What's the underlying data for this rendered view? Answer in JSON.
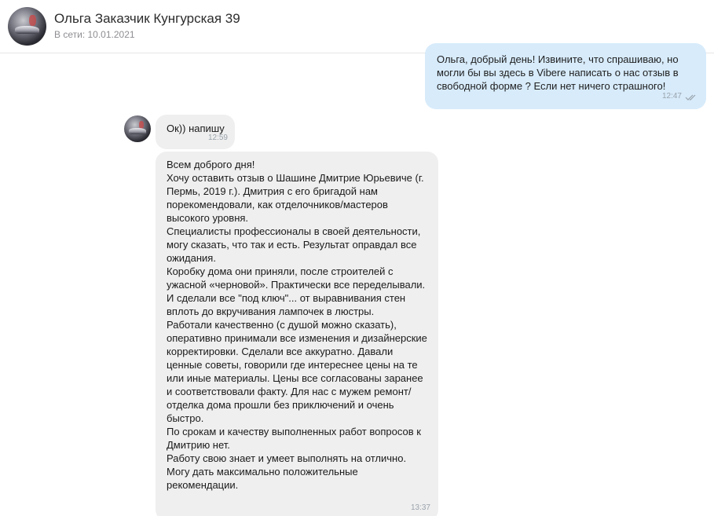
{
  "header": {
    "contact_name": "Ольга Заказчик Кунгурская 39",
    "status": "В сети: 10.01.2021"
  },
  "messages": {
    "outgoing": {
      "text": "Ольга, добрый день! Извините, что спрашиваю, но могли бы вы здесь в Vibere написать о нас отзыв в свободной форме ? Если нет ничего страшного!",
      "time": "12:47",
      "read_icon": "double-check-icon"
    },
    "incoming_short": {
      "text": "Ок)) напишу",
      "time": "12:59"
    },
    "incoming_long": {
      "paragraphs": [
        "Всем доброго дня!",
        "Хочу оставить отзыв о Шашине Дмитрие Юрьевиче (г. Пермь, 2019 г.). Дмитрия с его бригадой нам порекомендовали, как отделочников/мастеров высокого уровня.",
        "Специалисты профессионалы в своей деятельности, могу сказать, что так и есть. Результат оправдал все ожидания.",
        "Коробку дома они приняли, после строителей с ужасной «черновой». Практически все переделывали. И сделали все \"под ключ\"... от выравнивания стен вплоть до вкручивания лампочек в люстры.",
        "Работали качественно (с душой можно сказать), оперативно принимали все изменения и дизайнерские корректировки. Сделали все аккуратно. Давали ценные советы, говорили где интереснее цены на те или иные материалы. Цены все согласованы заранее и соответствовали факту. Для нас с мужем ремонт/отделка дома прошли без приключений и очень быстро.",
        "По срокам и качеству выполненных работ вопросов к Дмитрию нет.",
        "Работу свою знает и умеет выполнять на отлично.",
        "Могу дать максимально положительные рекомендации."
      ],
      "time": "13:37"
    }
  },
  "colors": {
    "outgoing_bubble": "#d7ebfb",
    "incoming_bubble": "#efefef",
    "timestamp": "#9aa3ab"
  }
}
